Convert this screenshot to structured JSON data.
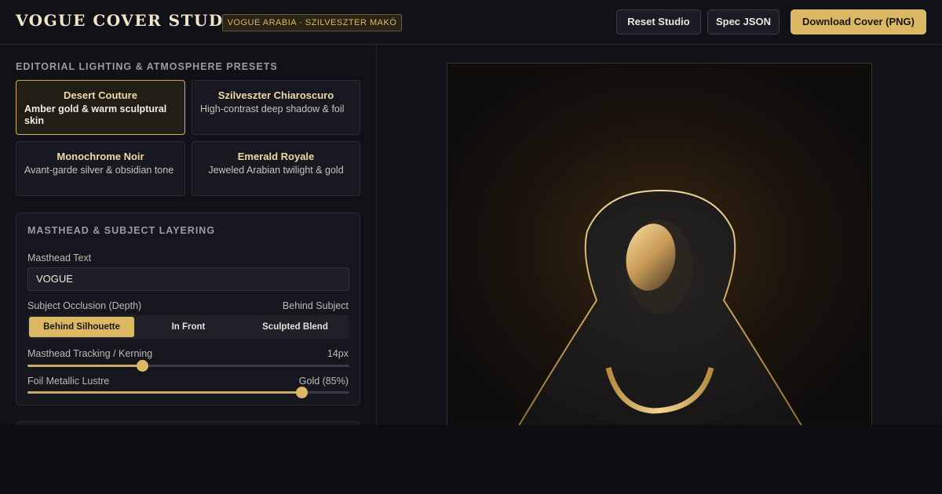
{
  "header": {
    "brand": "VOGUE COVER STUDIO",
    "badge": "VOGUE ARABIA · SZILVESZTER MAKÓ",
    "reset_label": "Reset Studio",
    "spec_label": "Spec JSON",
    "download_label": "Download Cover (PNG)"
  },
  "presets": {
    "title": "EDITORIAL LIGHTING & ATMOSPHERE PRESETS",
    "items": [
      {
        "name": "Desert Couture",
        "desc": "Amber gold & warm sculptural skin",
        "active": true
      },
      {
        "name": "Szilveszter Chiaroscuro",
        "desc": "High-contrast deep shadow & foil",
        "active": false
      },
      {
        "name": "Monochrome Noir",
        "desc": "Avant-garde silver & obsidian tone",
        "active": false
      },
      {
        "name": "Emerald Royale",
        "desc": "Jeweled Arabian twilight & gold",
        "active": false
      }
    ]
  },
  "masthead": {
    "title": "MASTHEAD & SUBJECT LAYERING",
    "text_label": "Masthead Text",
    "text_value": "VOGUE",
    "occlusion_label": "Subject Occlusion (Depth)",
    "occlusion_value": "Behind Subject",
    "occlusion_options": [
      "Behind Silhouette",
      "In Front",
      "Sculpted Blend"
    ],
    "tracking_label": "Masthead Tracking / Kerning",
    "tracking_value": "14px",
    "tracking_level": 0.355,
    "foil_label": "Foil Metallic Lustre",
    "foil_value": "Gold (85%)",
    "foil_level": 0.85
  },
  "colors": {
    "accent": "#dcb865",
    "background": "#111218",
    "cover_glow": "#3a2712"
  }
}
